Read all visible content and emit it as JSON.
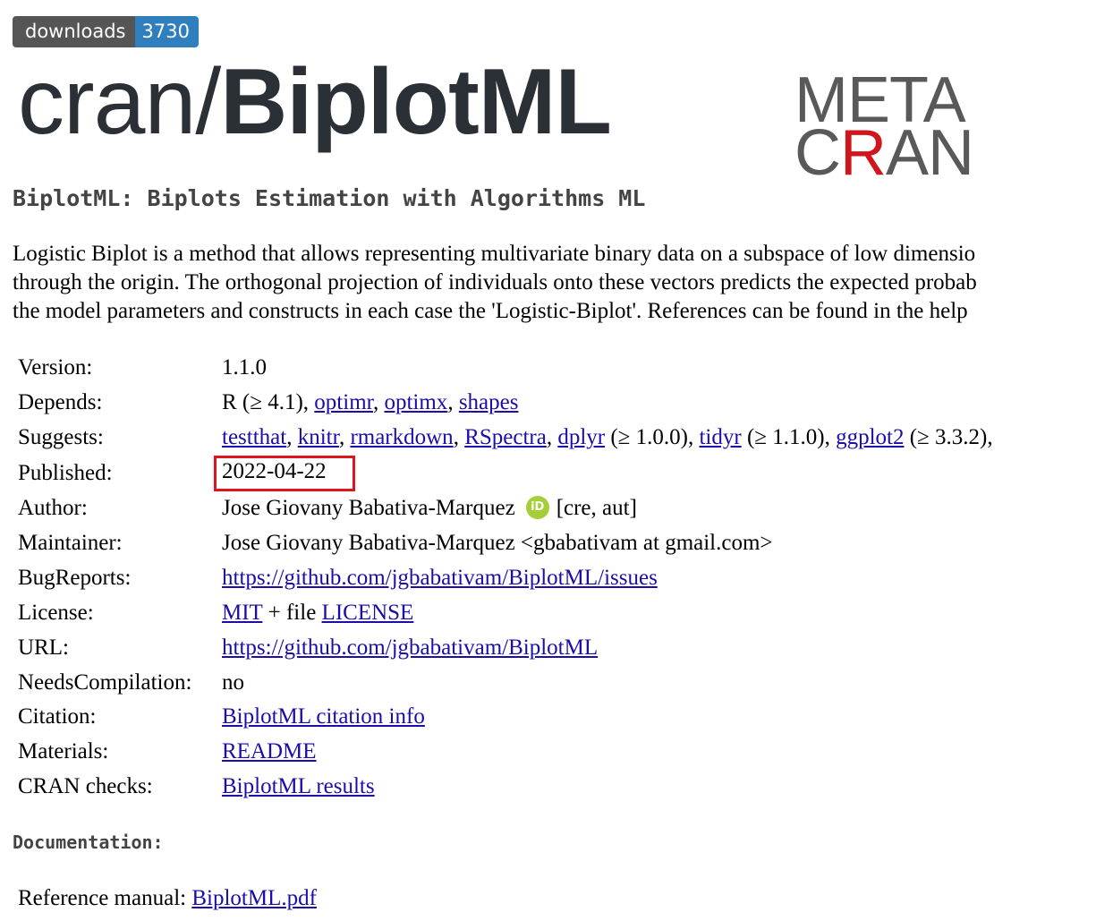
{
  "badge": {
    "label": "downloads",
    "count": "3730"
  },
  "title": {
    "prefix": "cran/",
    "package": "BiplotML"
  },
  "logo": {
    "line1": "META",
    "line2_pre": "C",
    "line2_red": "R",
    "line2_post": "AN"
  },
  "subtitle": "BiplotML: Biplots Estimation with Algorithms ML",
  "description": [
    "Logistic Biplot is a method that allows representing multivariate binary data on a subspace of low dimensio",
    "through the origin. The orthogonal projection of individuals onto these vectors predicts the expected probab",
    "the model parameters and constructs in each case the 'Logistic-Biplot'. References can be found in the help"
  ],
  "meta": {
    "version": {
      "key": "Version:",
      "value": "1.1.0"
    },
    "depends": {
      "key": "Depends:",
      "pre": "R (≥ 4.1), ",
      "links": [
        "optimr",
        "optimx",
        "shapes"
      ],
      "sep": ", "
    },
    "suggests": {
      "key": "Suggests:",
      "links": [
        "testthat",
        "knitr",
        "rmarkdown",
        "RSpectra",
        "dplyr",
        "tidyr",
        "ggplot2"
      ],
      "after_dplyr": " (≥ 1.0.0), ",
      "after_tidyr": " (≥ 1.1.0), ",
      "after_ggplot2": " (≥ 3.3.2),"
    },
    "published": {
      "key": "Published:",
      "value": "2022-04-22"
    },
    "author": {
      "key": "Author:",
      "name": "Jose Giovany Babativa-Marquez",
      "orcid": "iD",
      "roles": "[cre, aut]"
    },
    "maintainer": {
      "key": "Maintainer:",
      "value": "Jose Giovany Babativa-Marquez <gbabativam at gmail.com>"
    },
    "bugreports": {
      "key": "BugReports:",
      "link": "https://github.com/jgbabativam/BiplotML/issues"
    },
    "license": {
      "key": "License:",
      "link1": "MIT",
      "mid": " + file ",
      "link2": "LICENSE"
    },
    "url": {
      "key": "URL:",
      "link": "https://github.com/jgbabativam/BiplotML"
    },
    "needscompilation": {
      "key": "NeedsCompilation:",
      "value": "no"
    },
    "citation": {
      "key": "Citation:",
      "link": "BiplotML citation info"
    },
    "materials": {
      "key": "Materials:",
      "link": "README"
    },
    "cranchecks": {
      "key": "CRAN checks:",
      "link": "BiplotML results"
    }
  },
  "documentation": {
    "heading": "Documentation:",
    "refman_label": "Reference manual: ",
    "refman_link": "BiplotML.pdf"
  },
  "colors": {
    "link": "#1a0dab",
    "highlight_box": "#e0141c",
    "badge_label": "#555555",
    "badge_count": "#2f7fbf",
    "orcid": "#a6ce39",
    "logo_red": "#d0161c"
  }
}
